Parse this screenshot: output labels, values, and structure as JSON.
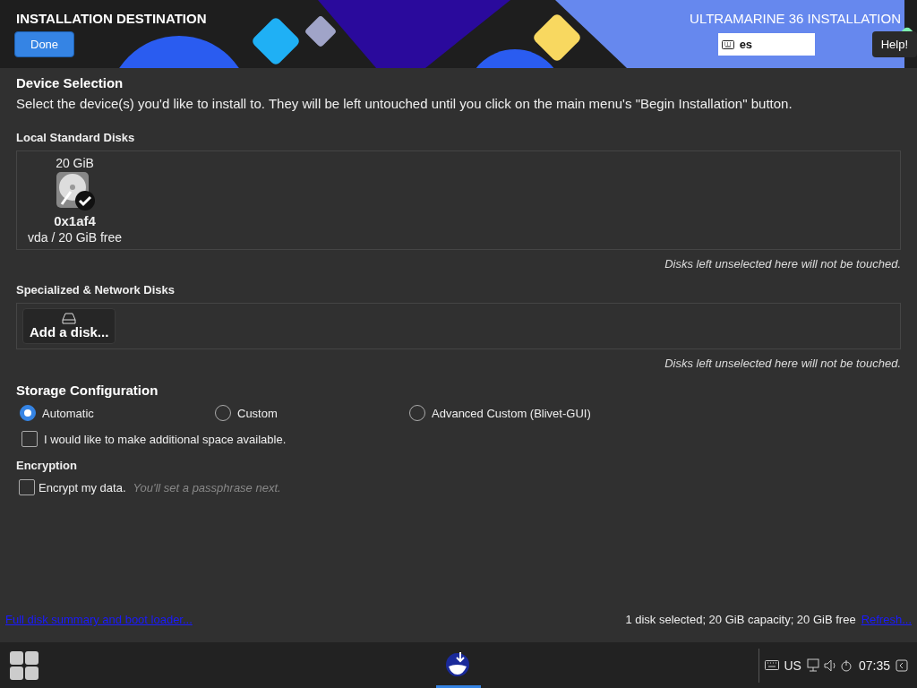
{
  "header": {
    "title": "INSTALLATION DESTINATION",
    "done": "Done",
    "product": "ULTRAMARINE 36 INSTALLATION",
    "keyboard_layout": "es",
    "help": "Help!"
  },
  "device_selection": {
    "heading": "Device Selection",
    "description": "Select the device(s) you'd like to install to.  They will be left untouched until you click on the main menu's \"Begin Installation\" button."
  },
  "local_disks": {
    "heading": "Local Standard Disks",
    "disks": [
      {
        "size": "20 GiB",
        "name": "0x1af4",
        "detail": "vda  /  20 GiB free",
        "selected": true
      }
    ],
    "note": "Disks left unselected here will not be touched."
  },
  "specialized_disks": {
    "heading": "Specialized & Network Disks",
    "add_button": "Add a disk...",
    "note": "Disks left unselected here will not be touched."
  },
  "storage_configuration": {
    "heading": "Storage Configuration",
    "options": [
      {
        "label": "Automatic",
        "selected": true
      },
      {
        "label": "Custom",
        "selected": false
      },
      {
        "label": "Advanced Custom (Blivet-GUI)",
        "selected": false
      }
    ],
    "additional_space": {
      "label": "I would like to make additional space available.",
      "checked": false
    }
  },
  "encryption": {
    "heading": "Encryption",
    "label": "Encrypt my data.",
    "checked": false,
    "hint": "You'll set a passphrase next."
  },
  "footer": {
    "link": "Full disk summary and boot loader...",
    "summary": "1 disk selected; 20 GiB capacity; 20 GiB free",
    "refresh": "Refresh..."
  },
  "taskbar": {
    "keyboard_layout": "US",
    "time": "07:35"
  }
}
